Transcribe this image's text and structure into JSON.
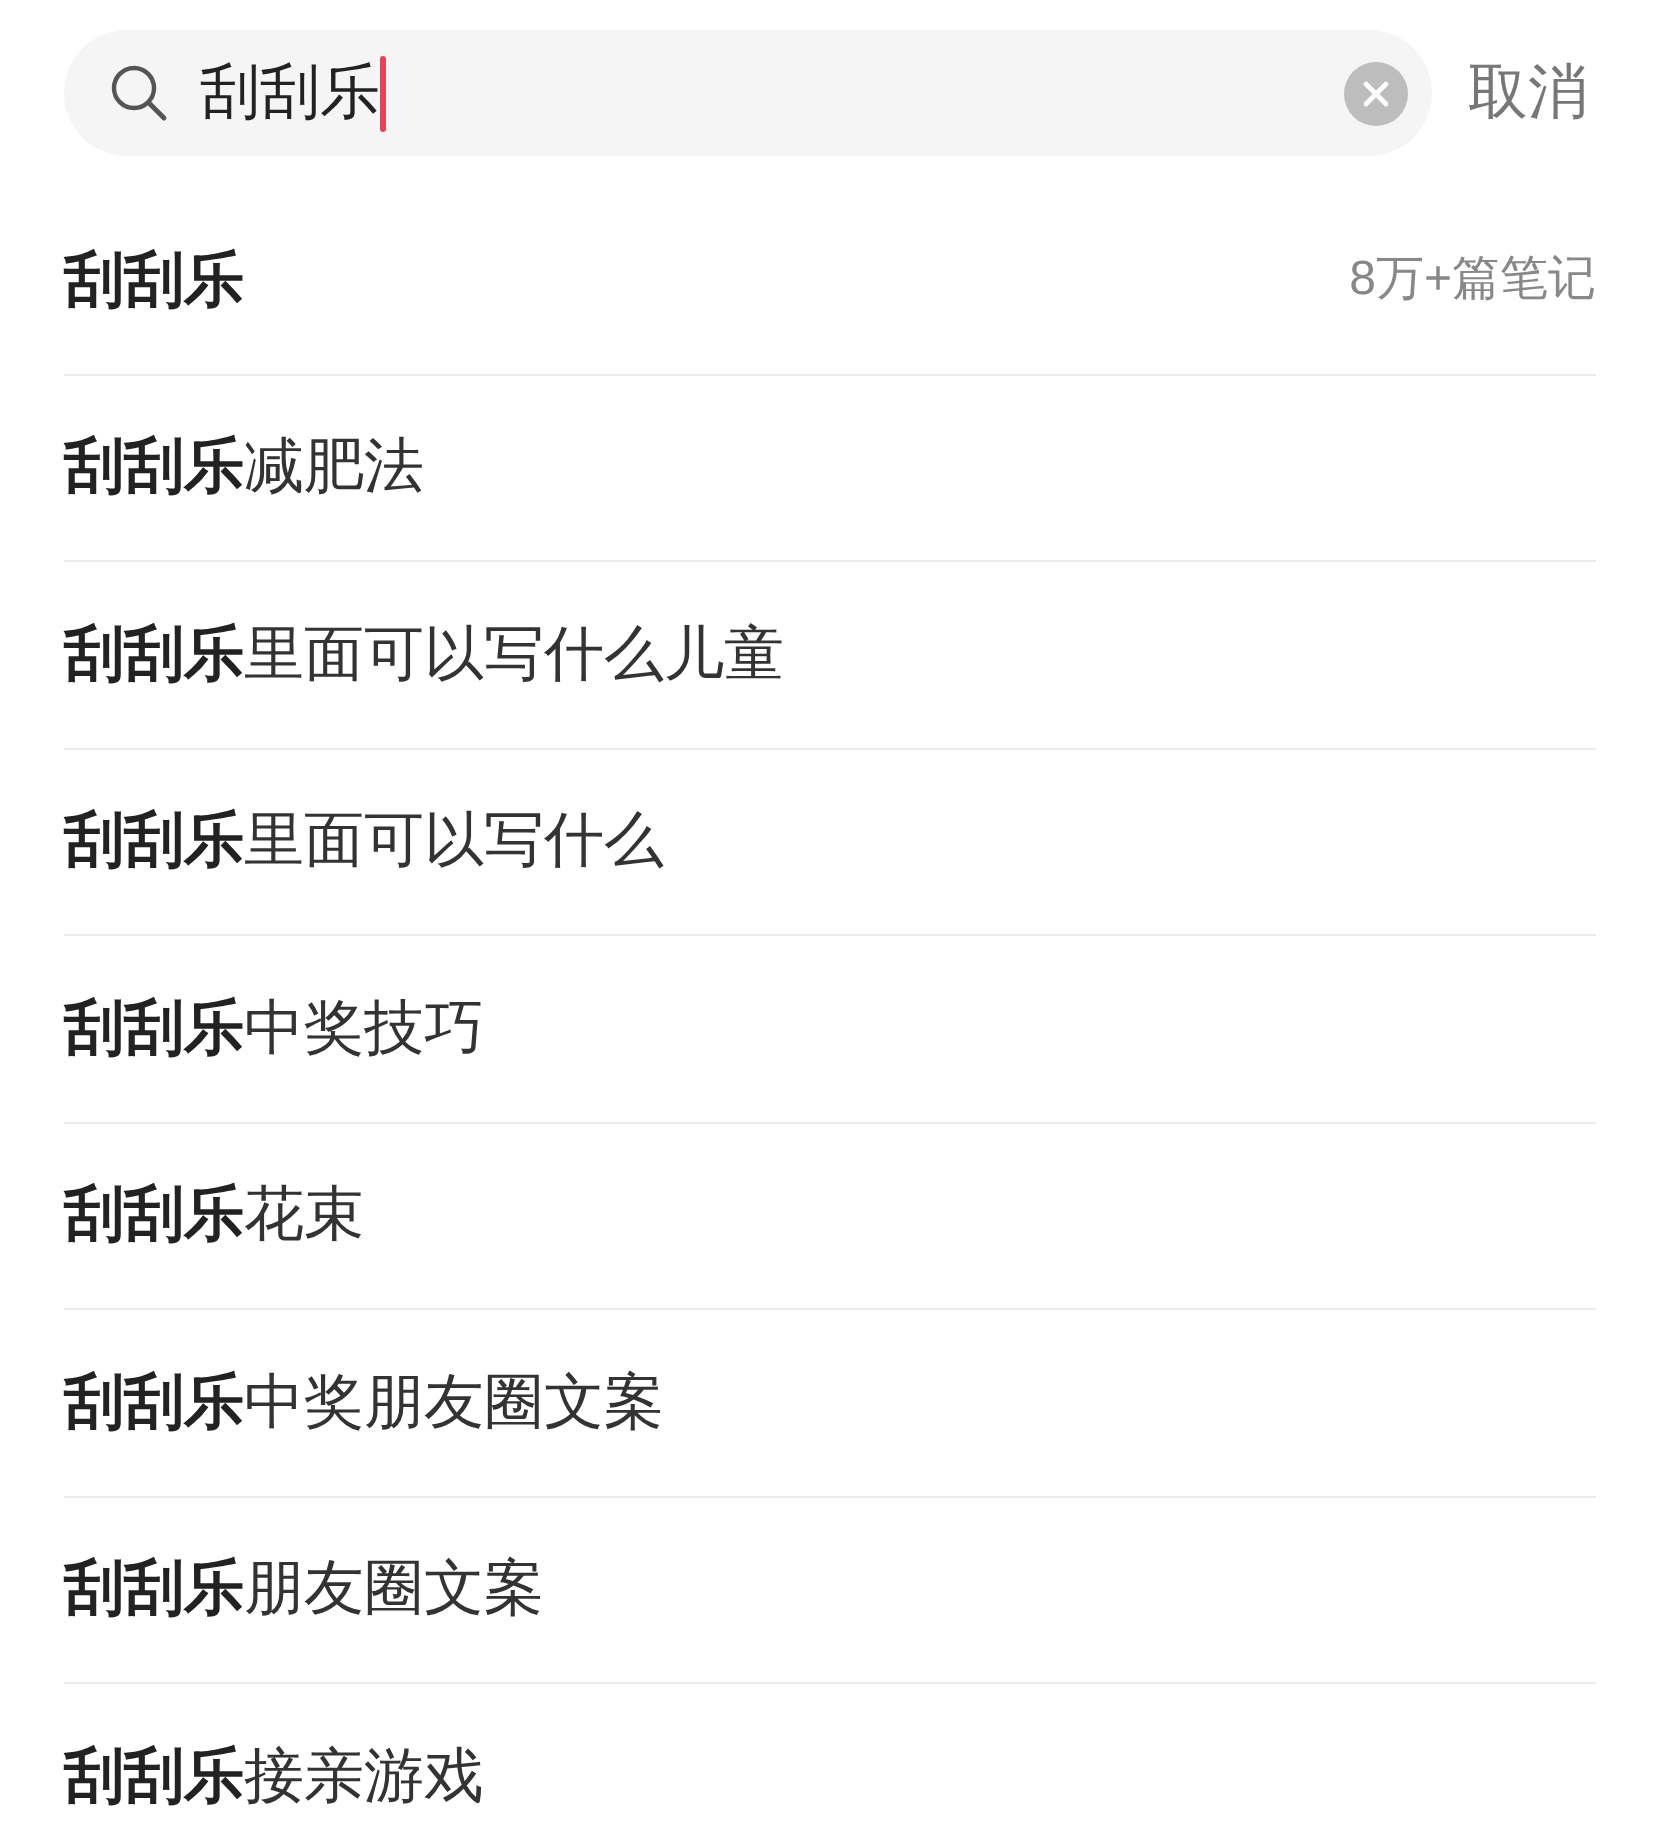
{
  "search": {
    "value": "刮刮乐"
  },
  "cancel": "取消",
  "suggestions": [
    {
      "kind": "topic",
      "text": "刮刮乐",
      "count": "8万+篇笔记"
    },
    {
      "kind": "suggestion",
      "text": "**刮刮乐**减肥法"
    },
    {
      "kind": "suggestion",
      "text": "**刮刮乐**里面可以写什么儿童"
    },
    {
      "kind": "suggestion",
      "text": "**刮刮乐**里面可以写什么"
    },
    {
      "kind": "suggestion",
      "text": "**刮刮乐**中奖技巧"
    },
    {
      "kind": "suggestion",
      "text": "**刮刮乐**花束"
    },
    {
      "kind": "suggestion",
      "text": "**刮刮乐**中奖朋友圈文案"
    },
    {
      "kind": "suggestion",
      "text": "**刮刮乐**朋友圈文案"
    },
    {
      "kind": "suggestion",
      "text": "**刮刮乐**接亲游戏"
    }
  ]
}
